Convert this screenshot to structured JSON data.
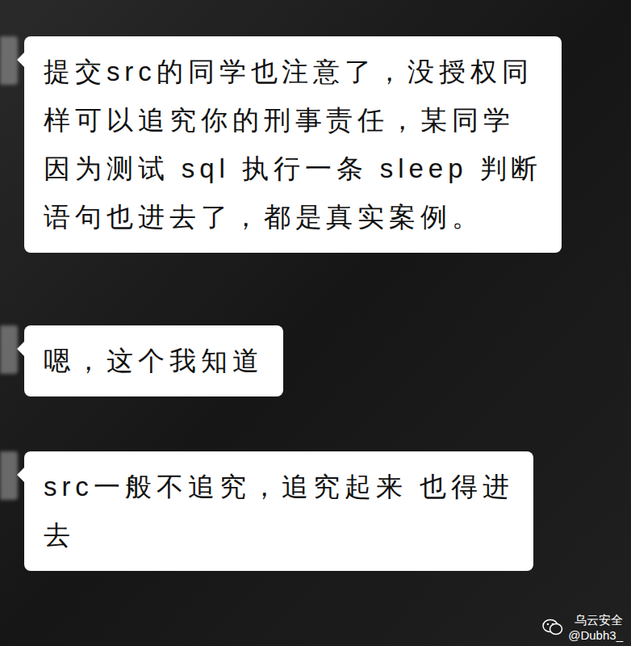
{
  "messages": [
    {
      "lines": [
        "提交src的同学也注意了，没授权同",
        "样可以追究你的刑事责任，某同学",
        "因为测试 sql 执行一条 sleep 判断",
        "语句也进去了，都是真实案例。"
      ]
    },
    {
      "lines": [
        "嗯，这个我知道"
      ]
    },
    {
      "lines": [
        "src一般不追究，追究起来 也得进",
        "去"
      ]
    }
  ],
  "watermark": {
    "account": "乌云安全",
    "handle": "@Dubh3_"
  }
}
